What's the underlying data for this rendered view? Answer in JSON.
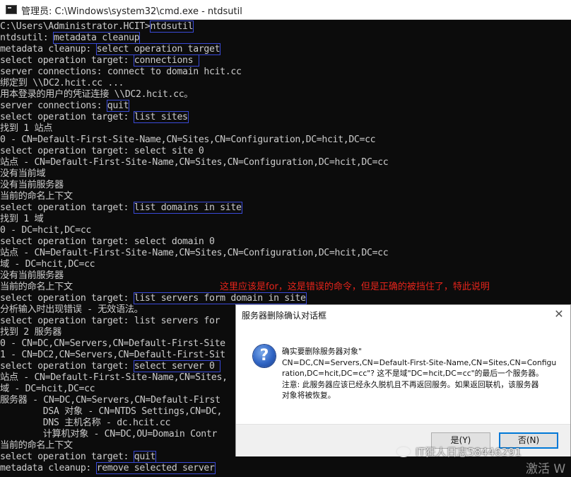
{
  "window": {
    "title": "管理员: C:\\Windows\\system32\\cmd.exe - ntdsutil"
  },
  "console": {
    "lines": [
      {
        "prefix": "C:\\Users\\Administrator.HCIT>",
        "cmd": "ntdsutil"
      },
      {
        "prefix": "ntdsutil: ",
        "cmd": "metadata cleanup"
      },
      {
        "prefix": "metadata cleanup: ",
        "cmd": "select operation target"
      },
      {
        "prefix": "select operation target: ",
        "cmd": "connections "
      },
      {
        "prefix": "server connections: connect to domain hcit.cc"
      },
      {
        "prefix": "绑定到 \\\\DC2.hcit.cc ..."
      },
      {
        "prefix": "用本登录的用户的凭证连接 \\\\DC2.hcit.cc。"
      },
      {
        "prefix": "server connections: ",
        "cmd": "quit"
      },
      {
        "prefix": "select operation target: ",
        "cmd": "list sites"
      },
      {
        "prefix": "找到 1 站点"
      },
      {
        "prefix": "0 - CN=Default-First-Site-Name,CN=Sites,CN=Configuration,DC=hcit,DC=cc"
      },
      {
        "prefix": "select operation target: select site 0"
      },
      {
        "prefix": "站点 - CN=Default-First-Site-Name,CN=Sites,CN=Configuration,DC=hcit,DC=cc"
      },
      {
        "prefix": "没有当前域"
      },
      {
        "prefix": "没有当前服务器"
      },
      {
        "prefix": "当前的命名上下文"
      },
      {
        "prefix": "select operation target: ",
        "cmd": "list domains in site"
      },
      {
        "prefix": "找到 1 域"
      },
      {
        "prefix": "0 - DC=hcit,DC=cc"
      },
      {
        "prefix": "select operation target: select domain 0"
      },
      {
        "prefix": "站点 - CN=Default-First-Site-Name,CN=Sites,CN=Configuration,DC=hcit,DC=cc"
      },
      {
        "prefix": "域 - DC=hcit,DC=cc"
      },
      {
        "prefix": "没有当前服务器"
      },
      {
        "prefix": "当前的命名上下文"
      },
      {
        "prefix": "select operation target: ",
        "cmd": "list servers form domain in site"
      },
      {
        "prefix": "分析输入时出现错误 - 无效语法。"
      },
      {
        "prefix": "select operation target: list servers for"
      },
      {
        "prefix": "找到 2 服务器"
      },
      {
        "prefix": "0 - CN=DC,CN=Servers,CN=Default-First-Site"
      },
      {
        "prefix": "1 - CN=DC2,CN=Servers,CN=Default-First-Sit"
      },
      {
        "prefix": "select operation target: ",
        "cmd": "select server 0 "
      },
      {
        "prefix": "站点 - CN=Default-First-Site-Name,CN=Sites,"
      },
      {
        "prefix": "域 - DC=hcit,DC=cc"
      },
      {
        "prefix": "服务器 - CN=DC,CN=Servers,CN=Default-First"
      },
      {
        "prefix": "        DSA 对象 - CN=NTDS Settings,CN=DC,"
      },
      {
        "prefix": "        DNS 主机名称 - dc.hcit.cc"
      },
      {
        "prefix": "        计算机对象 - CN=DC,OU=Domain Contr"
      },
      {
        "prefix": "当前的命名上下文"
      },
      {
        "prefix": "select operation target: ",
        "cmd": "quit"
      },
      {
        "prefix": "metadata cleanup: ",
        "cmd": "remove selected server"
      }
    ]
  },
  "annotation": {
    "text": "这里应该是for，这是错误的命令，但是正确的被挡住了，特此说明",
    "color": "#e6241b"
  },
  "dialog": {
    "title": "服务器删除确认对话框",
    "close_glyph": "✕",
    "icon_glyph": "?",
    "message_lines": [
      "确实要删除服务器对象\"",
      "CN=DC,CN=Servers,CN=Default-First-Site-Name,CN=Sites,CN=Configu",
      "ration,DC=hcit,DC=cc\"? 这不是域\"DC=hcit,DC=cc\"的最后一个服务器。",
      "注意: 此服务器应该已经永久脱机且不再返回服务。如果返回联机，该服务器",
      "对象将被恢复。"
    ],
    "yes_label": "是(Y)",
    "no_label": "否(N)"
  },
  "watermark": {
    "text": "IT狂人日志58446291",
    "activate": "激活 W"
  },
  "colors": {
    "console_bg": "#0c0c0c",
    "console_text": "#cccccc",
    "highlight_box": "#3a4ad8",
    "focus_button": "#0078d7"
  }
}
